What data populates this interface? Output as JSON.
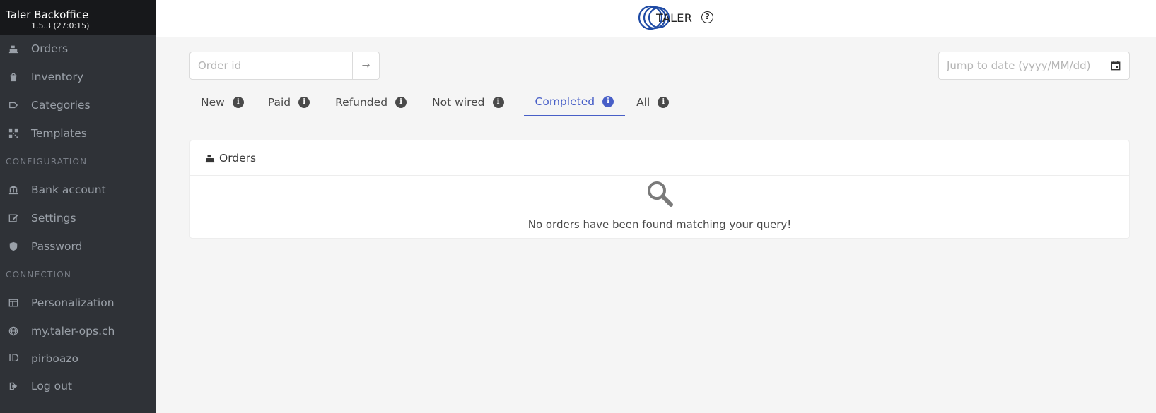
{
  "brand": {
    "title_bold": "Taler",
    "title_rest": " Backoffice",
    "version": "1.5.3 (27:0:15)"
  },
  "sidebar": {
    "items_top": [
      {
        "label": "Orders",
        "icon": "cash-register-icon"
      },
      {
        "label": "Inventory",
        "icon": "shopping-bag-icon"
      },
      {
        "label": "Categories",
        "icon": "tag-icon"
      },
      {
        "label": "Templates",
        "icon": "qrcode-icon"
      }
    ],
    "section_config": "CONFIGURATION",
    "items_config": [
      {
        "label": "Bank account",
        "icon": "bank-icon"
      },
      {
        "label": "Settings",
        "icon": "edit-icon"
      },
      {
        "label": "Password",
        "icon": "shield-icon"
      }
    ],
    "section_connection": "CONNECTION",
    "items_connection": [
      {
        "label": "Personalization",
        "icon": "layout-icon"
      },
      {
        "label": "my.taler-ops.ch",
        "icon": "globe-icon"
      },
      {
        "label": "pirboazo",
        "icon_text": "ID"
      },
      {
        "label": "Log out",
        "icon": "logout-icon"
      }
    ]
  },
  "header": {
    "logo_text": "TALER",
    "help": "?"
  },
  "search": {
    "placeholder": "Order id",
    "button": "→"
  },
  "date": {
    "placeholder": "Jump to date (yyyy/MM/dd)"
  },
  "tabs": [
    {
      "label": "New",
      "info": "i"
    },
    {
      "label": "Paid",
      "info": "i"
    },
    {
      "label": "Refunded",
      "info": "i"
    },
    {
      "label": "Not wired",
      "info": "i"
    },
    {
      "label": "Completed",
      "info": "i",
      "active": true
    },
    {
      "label": "All",
      "info": "i"
    }
  ],
  "card": {
    "title": "Orders",
    "empty_message": "No orders have been found matching your query!"
  },
  "colors": {
    "sidebar": "#2f3237",
    "accent": "#485fc7",
    "logo_blue": "#1f4ba5"
  }
}
